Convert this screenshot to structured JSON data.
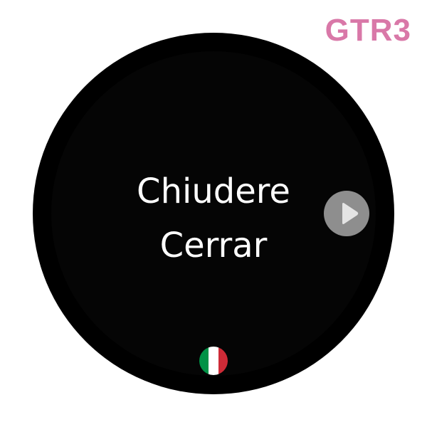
{
  "device_label": "GTR3",
  "card": {
    "word_source": "Chiudere",
    "word_target": "Cerrar"
  },
  "play_button": {
    "icon": "play-icon"
  },
  "language_flag": {
    "icon": "italy-flag-icon",
    "colors": [
      "#009246",
      "#ffffff",
      "#ce2b37"
    ]
  },
  "colors": {
    "label": "#d978a8",
    "bezel": "#000000",
    "button": "#8e8e8e"
  }
}
